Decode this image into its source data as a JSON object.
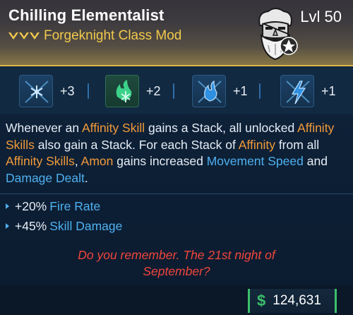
{
  "item": {
    "name": "Chilling Elementalist",
    "type": "Forgeknight Class Mod",
    "level": "Lvl 50",
    "rarity_color": "#f2c94c",
    "portrait_icon": "forgeknight-portrait-icon",
    "class_badge_icon": "class-badge-icon"
  },
  "skills": [
    {
      "icon": "cryo-skill-icon",
      "bonus": "+3"
    },
    {
      "icon": "cryo-affinity-skill-icon",
      "bonus": "+2"
    },
    {
      "icon": "fire-skill-icon",
      "bonus": "+1"
    },
    {
      "icon": "shock-skill-icon",
      "bonus": "+1"
    }
  ],
  "description": {
    "p1": "Whenever an ",
    "h1": "Affinity Skill",
    "p2": " gains a Stack, all unlocked ",
    "h2": "Affinity Skills",
    "p3": " also gain a Stack. For each Stack of ",
    "h3": "Affinity",
    "p4": " from all ",
    "h4": "Affinity Skills",
    "p5": ", ",
    "h5": "Amon",
    "p6": " gains increased ",
    "h6": "Movement Speed",
    "p7": " and ",
    "h7": "Damage Dealt",
    "p8": "."
  },
  "stats": [
    {
      "value": "+20%",
      "label": "Fire Rate"
    },
    {
      "value": "+45%",
      "label": "Skill Damage"
    }
  ],
  "flavor": {
    "line1": "Do you remember. The 21st night of",
    "line2": "September?"
  },
  "price": {
    "currency_icon": "$",
    "value": "124,631"
  },
  "colors": {
    "accent_orange": "#f29a3a",
    "accent_blue": "#4fb0f0",
    "flavor_red": "#f0463c",
    "money_green": "#3cc06a",
    "header_gold": "#d9b54a"
  }
}
